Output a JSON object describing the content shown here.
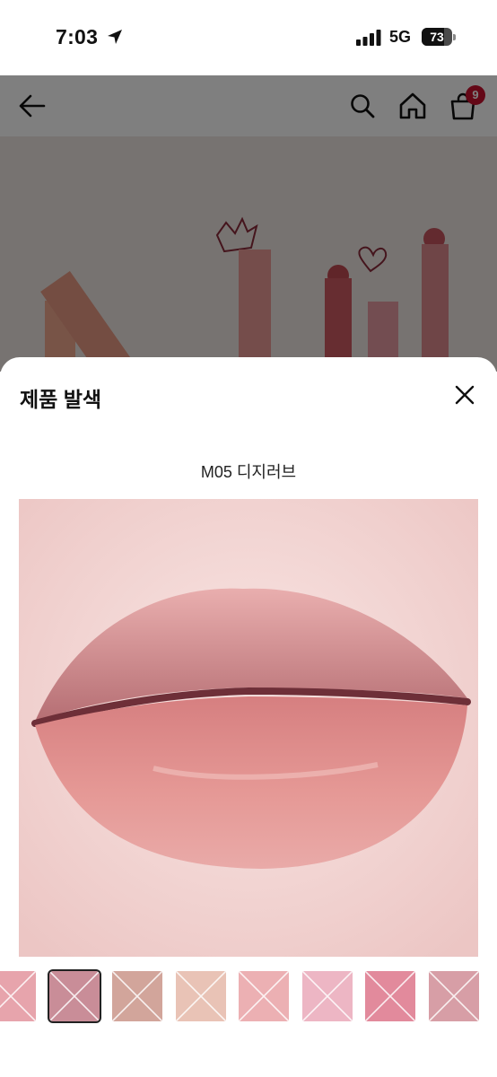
{
  "status_bar": {
    "time": "7:03",
    "network": "5G",
    "battery": "73",
    "battery_level": 0.73
  },
  "header": {
    "cart_count": "9",
    "icons": [
      "back-arrow-icon",
      "search-icon",
      "home-icon",
      "shopping-bag-icon"
    ]
  },
  "sheet": {
    "title": "제품 발색",
    "shade_name": "M05 디지러브",
    "selected_thumb_index": 1,
    "thumbs": [
      {
        "color": "#e7a4ac"
      },
      {
        "color": "#c98d98"
      },
      {
        "color": "#d2a59b"
      },
      {
        "color": "#e9c3b6"
      },
      {
        "color": "#ecb0b3"
      },
      {
        "color": "#edb6c4"
      },
      {
        "color": "#e28a9c"
      },
      {
        "color": "#d79ea6"
      }
    ]
  },
  "colors": {
    "accent_badge": "#c8102e",
    "overlay": "rgba(0,0,0,0.5)"
  }
}
